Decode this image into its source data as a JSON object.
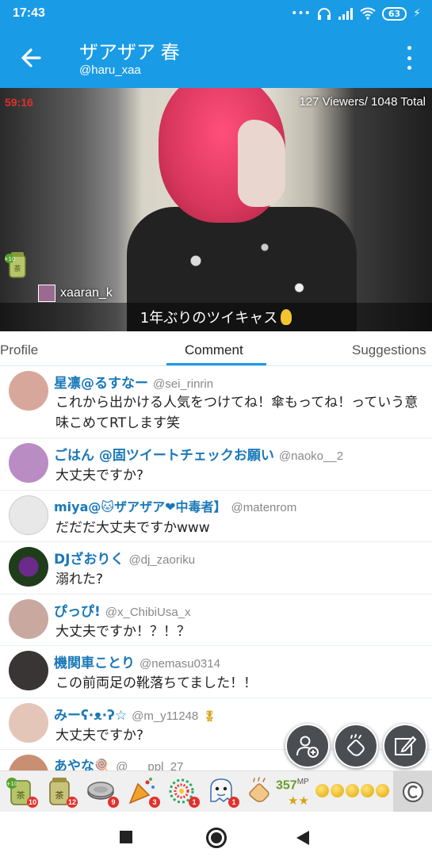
{
  "status_bar": {
    "time": "17:43",
    "battery": "63"
  },
  "header": {
    "title": "ザアザア 春",
    "subtitle": "@haru_xaa"
  },
  "video": {
    "timer": "59:16",
    "viewers": "127 Viewers/ 1048 Total",
    "viewer_chip": "xaaran_k",
    "caption": "1年ぶりのツイキャス"
  },
  "tabs": [
    {
      "label": "Profile",
      "active": false
    },
    {
      "label": "Comment",
      "active": true
    },
    {
      "label": "Suggestions",
      "active": false
    }
  ],
  "comments": [
    {
      "name": "星凛@るすなー",
      "handle": "@sei_rinrin",
      "text": "これから出かける人気をつけてね！傘もってね！っていう意味こめてRTします笑",
      "avatar_color": "#d8a79b"
    },
    {
      "name": "ごはん @固ツイートチェックお願い",
      "handle": "@naoko__2",
      "text": "大丈夫ですか?",
      "avatar_color": "#b98cc4"
    },
    {
      "name": "miya@🐱ザアザア❤中毒者】",
      "handle": "@matenrom",
      "text": "だだだ大丈夫ですかwww",
      "avatar_color": "#e8e8e8"
    },
    {
      "name": "DJざおりく",
      "handle": "@dj_zaoriku",
      "text": "溺れた?",
      "avatar_color": "#1f3d1a"
    },
    {
      "name": "ぴっぴ!",
      "handle": "@x_ChibiUsa_x",
      "text": "大丈夫ですか！？！？",
      "avatar_color": "#c9a8a0"
    },
    {
      "name": "機関車ことり",
      "handle": "@nemasu0314",
      "text": "この前両足の靴落ちてました！！",
      "avatar_color": "#3a3535"
    },
    {
      "name": "みーʕ·ᴥ·ʔ☆",
      "handle": "@m_y11248",
      "text": "大丈夫ですか?",
      "avatar_color": "#e3c6b8"
    },
    {
      "name": "あやな🍭",
      "handle": "@___ppl_27",
      "text": "",
      "avatar_color": "#c98f72"
    }
  ],
  "item_bar": {
    "items": [
      {
        "icon": "tea-plus10-icon",
        "count": "10"
      },
      {
        "icon": "tea-icon",
        "count": "12"
      },
      {
        "icon": "coin-stack-icon",
        "count": "9"
      },
      {
        "icon": "party-popper-icon",
        "count": "3"
      },
      {
        "icon": "firework-icon",
        "count": "1"
      },
      {
        "icon": "ghost-icon",
        "count": "1"
      },
      {
        "icon": "clap-icon",
        "count": ""
      }
    ],
    "mp_value": "357",
    "mp_unit": "MP",
    "stars": "★★"
  },
  "colors": {
    "brand": "#1a9be6",
    "name_link": "#1a78b8",
    "badge_red": "#e2312d"
  }
}
